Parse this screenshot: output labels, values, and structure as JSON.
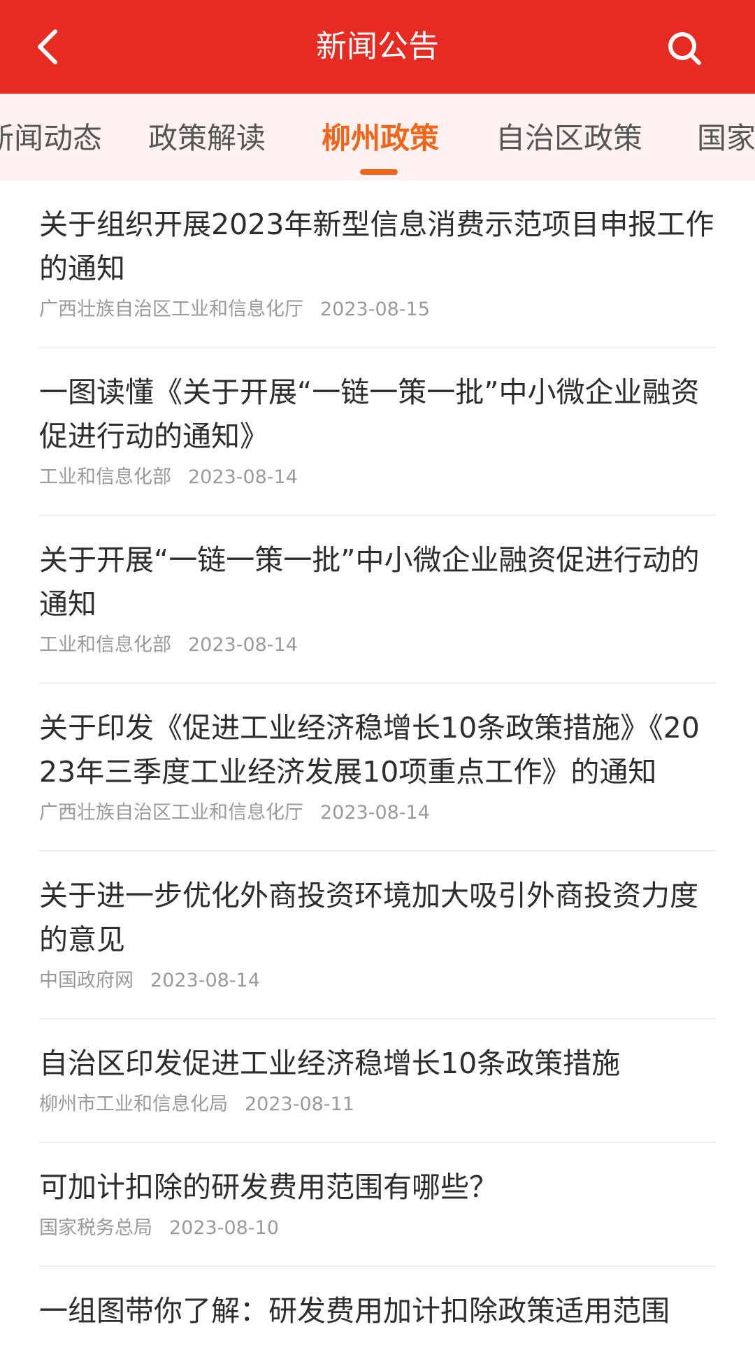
{
  "header": {
    "title": "新闻公告",
    "icons": {
      "back": "chevron-left-icon",
      "search": "search-icon"
    },
    "background": "#e52b22",
    "text_color": "#ffffff"
  },
  "tabs": [
    {
      "label": "新闻动态",
      "active": false
    },
    {
      "label": "政策解读",
      "active": false
    },
    {
      "label": "柳州政策",
      "active": true
    },
    {
      "label": "自治区政策",
      "active": false
    },
    {
      "label": "国家",
      "active": false
    }
  ],
  "tab_colors": {
    "active": "#f0651a",
    "inactive": "#555555",
    "bar_background": "#fff1f0"
  },
  "articles": [
    {
      "title": "关于组织开展2023年新型信息消费示范项目申报工作的通知",
      "source": "广西壮族自治区工业和信息化厅",
      "date": "2023-08-15"
    },
    {
      "title": "一图读懂《关于开展“一链一策一批”中小微企业融资促进行动的通知》",
      "source": "工业和信息化部",
      "date": "2023-08-14"
    },
    {
      "title": "关于开展“一链一策一批”中小微企业融资促进行动的通知",
      "source": "工业和信息化部",
      "date": "2023-08-14"
    },
    {
      "title": "关于印发《促进工业经济稳增长10条政策措施》《2023年三季度工业经济发展10项重点工作》的通知",
      "source": "广西壮族自治区工业和信息化厅",
      "date": "2023-08-14"
    },
    {
      "title": "关于进一步优化外商投资环境加大吸引外商投资力度的意见",
      "source": "中国政府网",
      "date": "2023-08-14"
    },
    {
      "title": "自治区印发促进工业经济稳增长10条政策措施",
      "source": "柳州市工业和信息化局",
      "date": "2023-08-11"
    },
    {
      "title": "可加计扣除的研发费用范围有哪些？",
      "source": "国家税务总局",
      "date": "2023-08-10"
    },
    {
      "title": "一组图带你了解：研发费用加计扣除政策适用范围",
      "source": "",
      "date": ""
    }
  ]
}
